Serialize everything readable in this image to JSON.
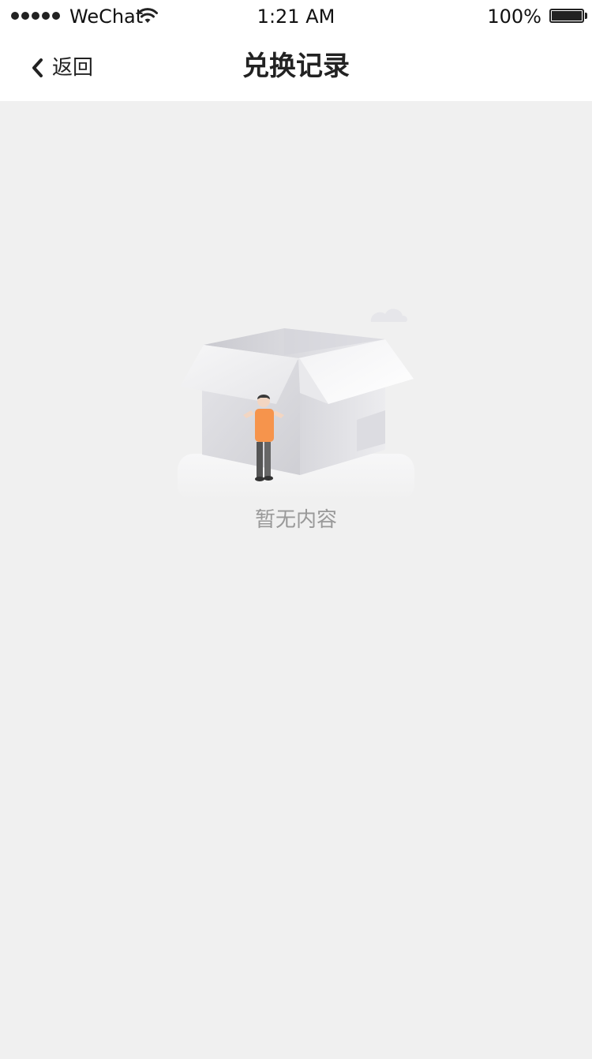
{
  "status_bar": {
    "carrier": "WeChat",
    "time": "1:21 AM",
    "battery": "100%",
    "signal_icon": "signal-dots-icon",
    "wifi_icon": "wifi-icon",
    "battery_icon": "battery-icon"
  },
  "nav": {
    "back_label": "返回",
    "back_icon": "chevron-left-icon",
    "title": "兑换记录"
  },
  "empty_state": {
    "illustration_icon": "empty-box-icon",
    "message": "暂无内容"
  },
  "colors": {
    "background": "#f0f0f0",
    "bar_background": "#ffffff",
    "text_primary": "#222222",
    "text_muted": "#999999",
    "figure_shirt": "#f6944c"
  }
}
